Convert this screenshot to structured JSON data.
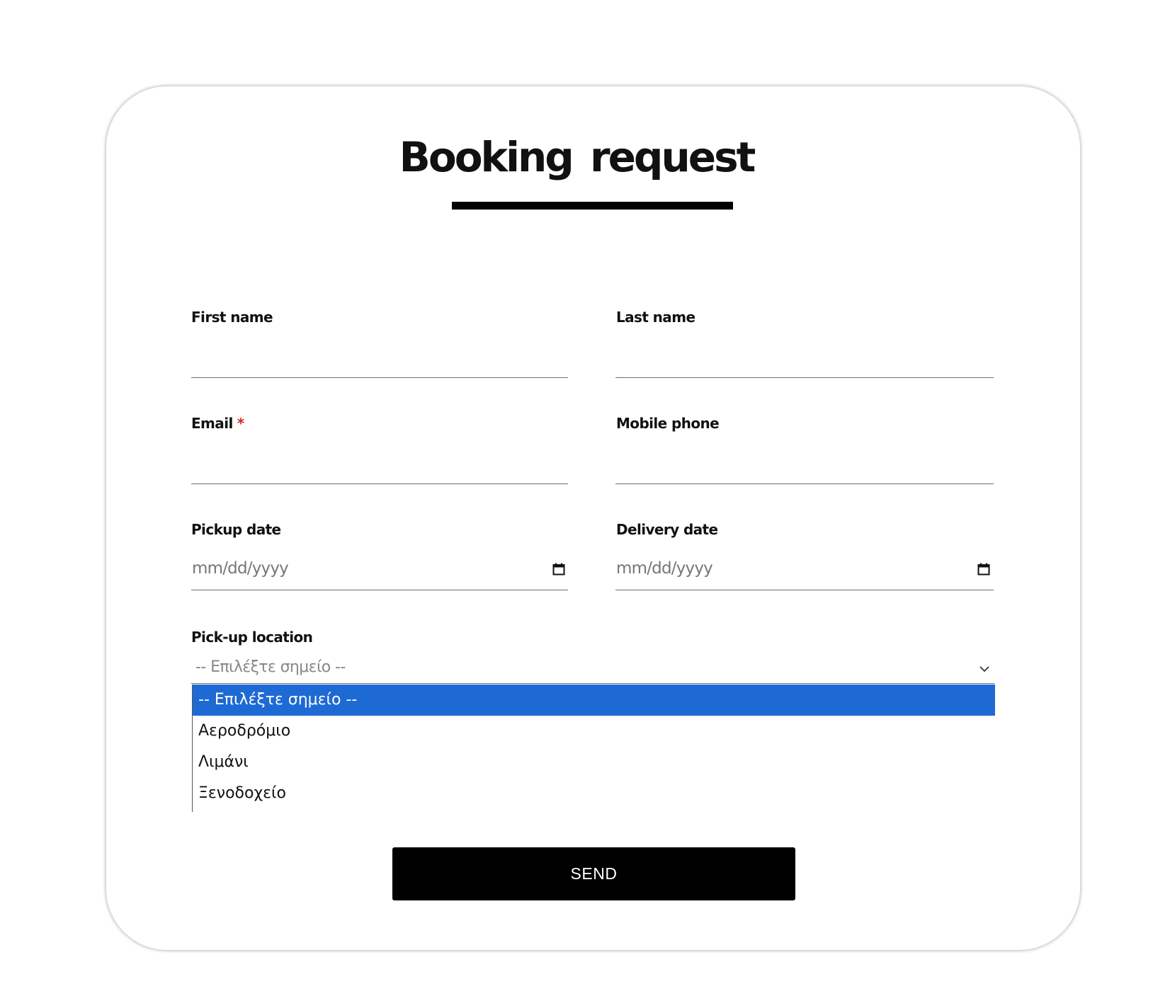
{
  "form": {
    "title": "Booking request",
    "fields": {
      "first_name": {
        "label": "First name",
        "value": ""
      },
      "last_name": {
        "label": "Last name",
        "value": ""
      },
      "email": {
        "label": "Email",
        "required_marker": "*",
        "value": ""
      },
      "mobile_phone": {
        "label": "Mobile phone",
        "value": ""
      },
      "pickup_date": {
        "label": "Pickup date",
        "placeholder": "mm/dd/yyyy"
      },
      "delivery_date": {
        "label": "Delivery date",
        "placeholder": "mm/dd/yyyy"
      }
    },
    "pickup_location": {
      "label": "Pick-up location",
      "selected": "-- Επιλέξτε σημείο --",
      "options": [
        "-- Επιλέξτε σημείο --",
        "Αεροδρόμιο",
        "Λιμάνι",
        "Ξενοδοχείο"
      ],
      "highlighted_index": 0
    },
    "send_label": "SEND"
  },
  "colors": {
    "required": "#e02424",
    "option_highlight": "#1d6ad4",
    "button_bg": "#000000"
  },
  "icons": {
    "date": "calendar-icon",
    "select": "chevron-down-icon"
  }
}
